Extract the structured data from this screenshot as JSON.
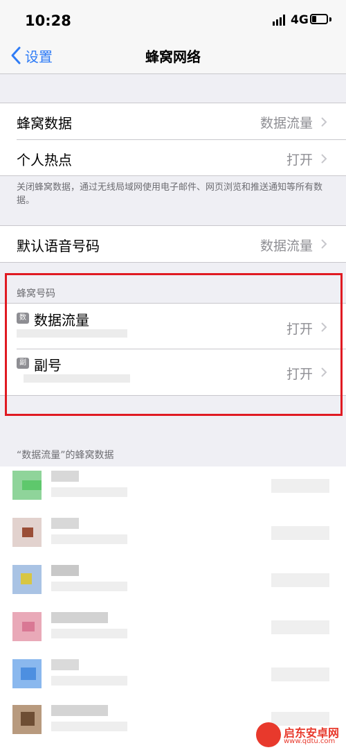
{
  "status_bar": {
    "time": "10:28",
    "network": "4G"
  },
  "nav": {
    "back_label": "设置",
    "title": "蜂窝网络"
  },
  "group1": {
    "cellular_data": {
      "label": "蜂窝数据",
      "value": "数据流量"
    },
    "hotspot": {
      "label": "个人热点",
      "value": "打开"
    }
  },
  "note": "关闭蜂窝数据，通过无线局域网使用电子邮件、网页浏览和推送通知等所有数据。",
  "group2": {
    "default_voice": {
      "label": "默认语音号码",
      "value": "数据流量"
    }
  },
  "sim_section": {
    "header": "蜂窝号码",
    "items": [
      {
        "badge": "数",
        "label": "数据流量",
        "value": "打开"
      },
      {
        "badge": "副",
        "label": "副号",
        "value": "打开"
      }
    ]
  },
  "usage_section": {
    "header": "“数据流量”的蜂窝数据"
  },
  "watermark": {
    "brand": "启东安卓网",
    "url": "www.qdtu.com"
  },
  "colors": {
    "accent": "#2f7cf6",
    "highlight": "#e01a22"
  }
}
